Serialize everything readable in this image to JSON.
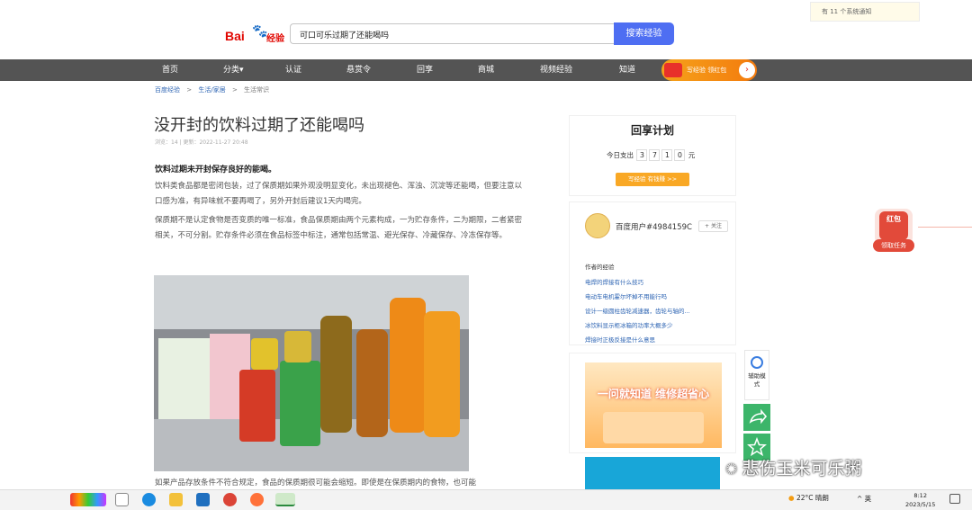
{
  "notice": {
    "text": "有 11 个系统通知"
  },
  "logo": {
    "bai": "Bai",
    "jy": "经验"
  },
  "search": {
    "query": "可口可乐过期了还能喝吗",
    "button": "搜索经验"
  },
  "nav": {
    "items": [
      "首页",
      "分类▾",
      "认证",
      "悬赏令",
      "回享",
      "商城",
      "视频经验",
      "知道"
    ],
    "promo": "写经验 领红包"
  },
  "breadcrumb": [
    "百度经验",
    ">",
    "生活/家居",
    ">",
    "生活常识"
  ],
  "article": {
    "title": "没开封的饮料过期了还能喝吗",
    "meta": "浏览：14 | 更新：2022-11-27 20:48",
    "intro": "饮料过期未开封保存良好的能喝。",
    "para1": "饮料类食品都是密闭包装，过了保质期如果外观没明显变化，未出现褪色、浑浊、沉淀等还能喝，但要注意以口感为准，有异味就不要再喝了，另外开封后建议1天内喝完。",
    "para2": "保质期不是认定食物是否变质的唯一标准，食品保质期由两个元素构成，一为贮存条件，二为期限，二者紧密相关，不可分割。贮存条件必须在食品标签中标注，通常包括常温、避光保存、冷藏保存、冷冻保存等。",
    "bottom": "如果产品存放条件不符合规定，食品的保质期很可能会缩短。即使是在保质期内的食物，也可能"
  },
  "sidebar": {
    "title": "回享计划",
    "spend_label": "今日支出",
    "digits": [
      "3",
      "7",
      "1",
      "0"
    ],
    "unit": "元",
    "btn": "写经验 有钱赚 >>",
    "username": "百度用户#4984159C",
    "follow": "+ 关注",
    "author_title": "作者的经验",
    "links": [
      "电焊的焊接有什么技巧",
      "电动车电机霍尔坏掉不用能行吗",
      "设计一级圆柱齿轮减速器，齿轮与轴的...",
      "冰饮料显示柜冰箱的功率大概多少",
      "焊接时正极反接是什么意思"
    ]
  },
  "ad": {
    "headline": "一问就知道 维修超省心"
  },
  "float": {
    "assist": "辅助模式"
  },
  "redpacket": {
    "title": "红包",
    "task": "领取任务"
  },
  "watermark": "悲伤玉米可乐粥",
  "taskbar": {
    "weather": "22°C 晴朗",
    "tray": "^ 英",
    "time": "8:12",
    "date": "2023/5/15"
  },
  "colors": {
    "nav_bg": "#545454",
    "search_btn": "#4e6ef2",
    "brand_red": "#e10601",
    "link": "#2d64b3"
  }
}
